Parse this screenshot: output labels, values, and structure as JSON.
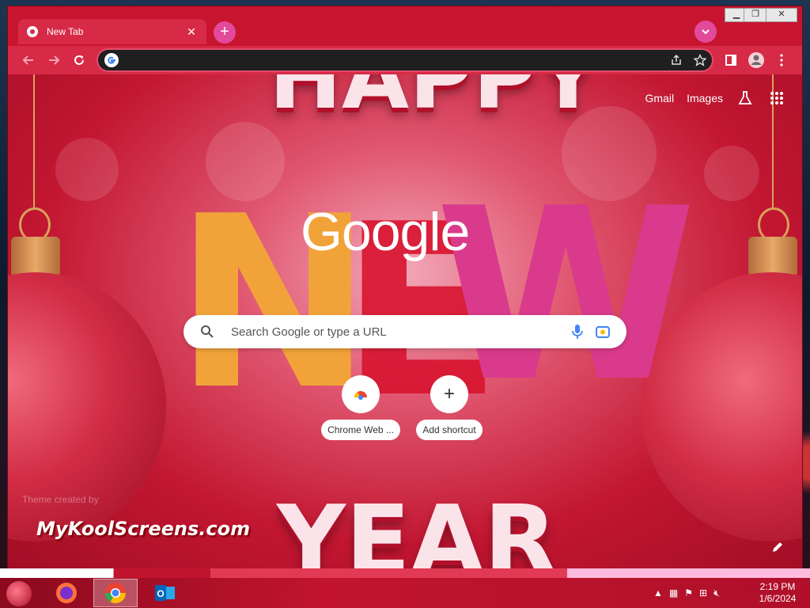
{
  "browser": {
    "tab_title": "New Tab",
    "address_value": "",
    "colors": {
      "frame": "#c8152f",
      "accent": "#e24a9b"
    }
  },
  "ntp": {
    "gmail_label": "Gmail",
    "images_label": "Images",
    "logo_text": "Google",
    "search_placeholder": "Search Google or type a URL",
    "shortcuts": [
      {
        "label": "Chrome Web ...",
        "icon": "chrome-web-store-icon"
      },
      {
        "label": "Add shortcut",
        "icon": "plus-icon"
      }
    ],
    "theme_credit": "Theme created by",
    "brand_text": "MyKoolScreens.com",
    "background_words": {
      "top": "HAPPY",
      "middle": "NEW",
      "bottom": "YEAR"
    }
  },
  "taskbar": {
    "apps": [
      "firefox-icon",
      "chrome-icon",
      "outlook-icon"
    ],
    "time": "2:19 PM",
    "date": "1/6/2024"
  }
}
